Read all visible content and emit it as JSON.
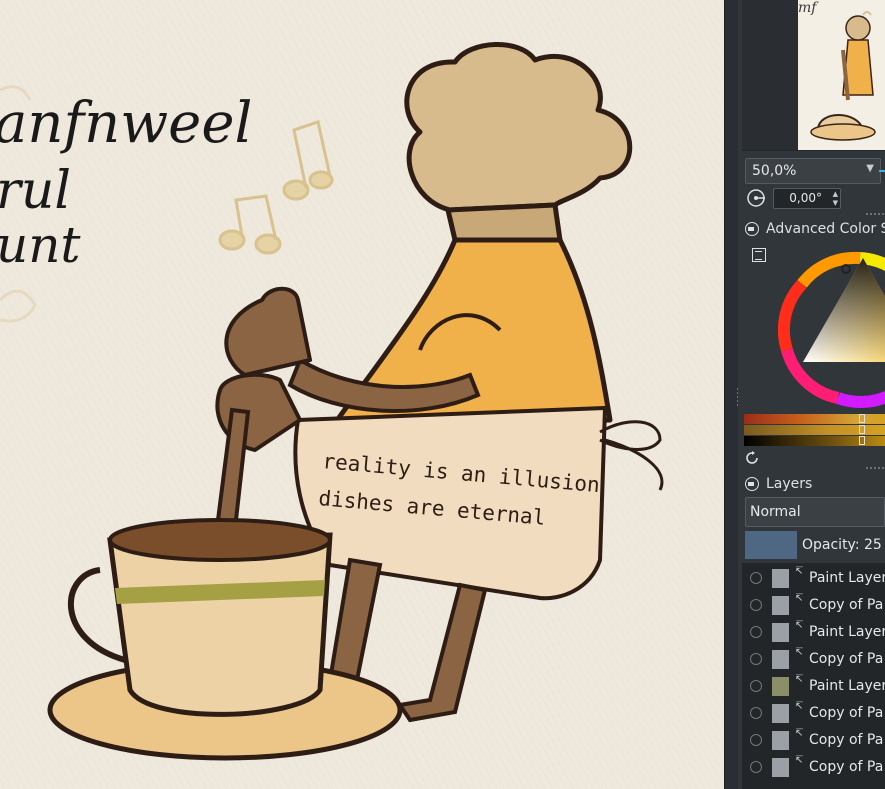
{
  "canvas": {
    "handwriting_lines": [
      "anfnweel",
      "rul",
      "unt"
    ],
    "apron_text": [
      "reality is an illusion",
      "dishes are eternal"
    ]
  },
  "panel": {
    "zoom": {
      "value": "50,0%"
    },
    "rotation": {
      "value": "0,00°"
    },
    "advanced_color": {
      "title": "Advanced Color S"
    },
    "layers": {
      "title": "Layers",
      "blend_mode": "Normal",
      "opacity_label": "Opacity:  25",
      "items": [
        {
          "name": "Paint Layer"
        },
        {
          "name": "Copy of Pa"
        },
        {
          "name": "Paint Layer"
        },
        {
          "name": "Copy of Pa"
        },
        {
          "name": "Paint Layer"
        },
        {
          "name": "Copy of Pa"
        },
        {
          "name": "Copy of Pa"
        },
        {
          "name": "Copy of Pa"
        }
      ]
    }
  },
  "colors": {
    "canvas_bg": "#efe9dd",
    "panel_bg": "#31363b",
    "accent": "#3daee9",
    "opacity_swatch": "#4e6884",
    "ink": "#3a2418"
  }
}
